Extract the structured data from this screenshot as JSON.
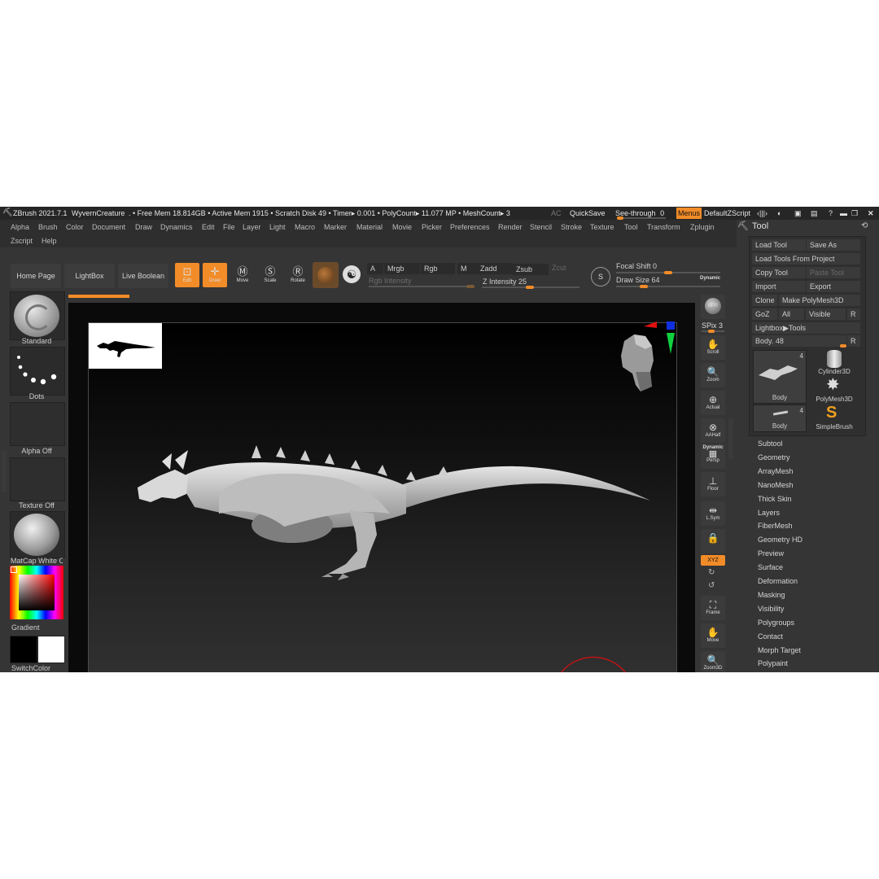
{
  "titlebar": {
    "app": "ZBrush 2021.7.1",
    "document": "WyvernCreature",
    "stats": ". • Free Mem 18.814GB • Active Mem 1915 • Scratch Disk 49 • Timer▸ 0.001 • PolyCount▸ 11.077 MP • MeshCount▸ 3",
    "ac": "AC",
    "quicksave": "QuickSave",
    "see_through": "See-through",
    "see_through_value": "0",
    "menus": "Menus",
    "script": "DefaultZScript"
  },
  "menubar": {
    "row1": [
      "Alpha",
      "Brush",
      "Color",
      "Document",
      "Draw",
      "Dynamics",
      "Edit",
      "File",
      "Layer",
      "Light",
      "Macro",
      "Marker",
      "Material",
      "Movie",
      "Picker",
      "Preferences",
      "Render",
      "Stencil",
      "Stroke",
      "Texture",
      "Tool",
      "Transform",
      "Zplugin"
    ],
    "row2": [
      "Zscript",
      "Help"
    ]
  },
  "shelf": {
    "home": "Home Page",
    "lightbox": "LightBox",
    "live_boolean": "Live Boolean",
    "edit": "Edit",
    "draw": "Draw",
    "move": "Move",
    "scale": "Scale",
    "rotate": "Rotate",
    "a": "A",
    "mrgb": "Mrgb",
    "rgb": "Rgb",
    "m": "M",
    "rgb_intensity": "Rgb Intensity",
    "zadd": "Zadd",
    "zsub": "Zsub",
    "zcut": "Zcut",
    "z_intensity": "Z Intensity 25",
    "focal_shift": "Focal Shift 0",
    "draw_size": "Draw Size 64",
    "dynamic": "Dynamic"
  },
  "leftpanel": {
    "brush": "Standard",
    "stroke": "Dots",
    "alpha": "Alpha Off",
    "texture": "Texture Off",
    "material": "MatCap White C",
    "gradient": "Gradient",
    "switch": "SwitchColor"
  },
  "rightshelf": {
    "bpr": "BPR",
    "spix": "SPix 3",
    "scroll": "Scroll",
    "zoom": "Zoom",
    "actual": "Actual",
    "aahalf": "AAHalf",
    "dynamic": "Dynamic",
    "persp": "Persp",
    "floor": "Floor",
    "lsym": "L.Sym",
    "xyz": "XYZ",
    "frame": "Frame",
    "move": "Move",
    "zoom3d": "Zoom3D"
  },
  "tool": {
    "title": "Tool",
    "load_tool": "Load Tool",
    "save_as": "Save As",
    "load_from_project": "Load Tools From Project",
    "copy_tool": "Copy Tool",
    "paste_tool": "Paste Tool",
    "import": "Import",
    "export": "Export",
    "clone": "Clone",
    "make_polymesh": "Make PolyMesh3D",
    "goz": "GoZ",
    "all": "All",
    "visible": "Visible",
    "r": "R",
    "lightbox_tools": "Lightbox▶Tools",
    "body_slider": "Body. 48",
    "thumbs": [
      {
        "label": "Body",
        "count": "4"
      },
      {
        "label": "Cylinder3D"
      },
      {
        "label": "PolyMesh3D"
      },
      {
        "label": "Body",
        "count": "4"
      },
      {
        "label": "SimpleBrush"
      }
    ],
    "subpalettes": [
      "Subtool",
      "Geometry",
      "ArrayMesh",
      "NanoMesh",
      "Thick Skin",
      "Layers",
      "FiberMesh",
      "Geometry HD",
      "Preview",
      "Surface",
      "Deformation",
      "Masking",
      "Visibility",
      "Polygroups",
      "Contact",
      "Morph Target",
      "Polypaint"
    ]
  },
  "colors": {
    "accent": "#f28c28",
    "panel": "#353535",
    "canvas": "#0a0a0a"
  }
}
